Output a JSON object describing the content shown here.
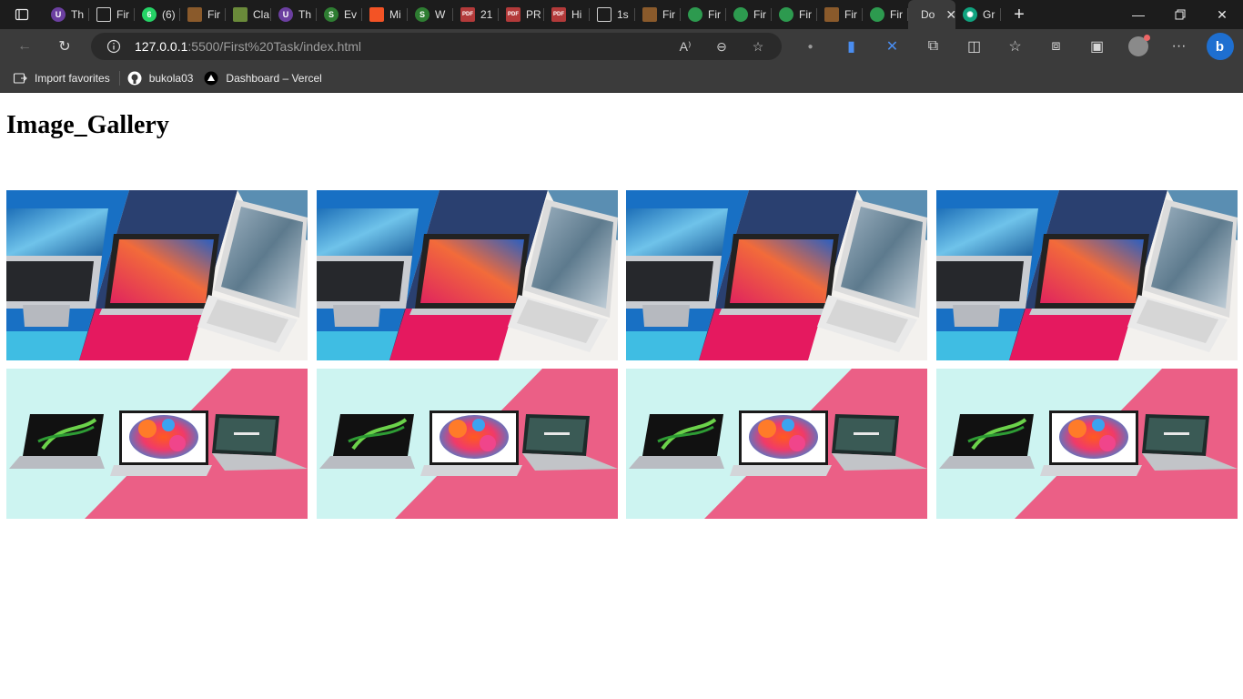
{
  "tabs": [
    {
      "label": "Th",
      "icon": "udemy-icon",
      "color": "#6b3fa0",
      "glyph": "U"
    },
    {
      "label": "Fir",
      "icon": "document-icon",
      "color": "#9a9a9a",
      "glyph": ""
    },
    {
      "label": "(6)",
      "icon": "whatsapp-icon",
      "color": "#25d366",
      "glyph": "6"
    },
    {
      "label": "Fir",
      "icon": "classroom-icon",
      "color": "#8a5a2b",
      "glyph": ""
    },
    {
      "label": "Cla",
      "icon": "classroom-icon",
      "color": "#6a8a3a",
      "glyph": ""
    },
    {
      "label": "Th",
      "icon": "udemy-icon",
      "color": "#6b3fa0",
      "glyph": "U"
    },
    {
      "label": "Ev",
      "icon": "s-icon",
      "color": "#2e7d32",
      "glyph": "S"
    },
    {
      "label": "Mi",
      "icon": "microsoft-icon",
      "color": "#f35325",
      "glyph": ""
    },
    {
      "label": "W",
      "icon": "s-icon",
      "color": "#2e7d32",
      "glyph": "S"
    },
    {
      "label": "21",
      "icon": "pdf-icon",
      "color": "#b33a3a",
      "glyph": "PDF"
    },
    {
      "label": "PR",
      "icon": "pdf-icon",
      "color": "#b33a3a",
      "glyph": "PDF"
    },
    {
      "label": "Hi",
      "icon": "pdf-icon",
      "color": "#b33a3a",
      "glyph": "PDF"
    },
    {
      "label": "1s",
      "icon": "document-icon",
      "color": "#9a9a9a",
      "glyph": ""
    },
    {
      "label": "Fir",
      "icon": "classroom-icon",
      "color": "#8a5a2b",
      "glyph": ""
    },
    {
      "label": "Fir",
      "icon": "drive-icon",
      "color": "#2d9a4f",
      "glyph": ""
    },
    {
      "label": "Fir",
      "icon": "drive-icon",
      "color": "#2d9a4f",
      "glyph": ""
    },
    {
      "label": "Fir",
      "icon": "drive-icon",
      "color": "#2d9a4f",
      "glyph": ""
    },
    {
      "label": "Fir",
      "icon": "classroom-icon",
      "color": "#8a5a2b",
      "glyph": ""
    },
    {
      "label": "Fir",
      "icon": "drive-icon",
      "color": "#2d9a4f",
      "glyph": ""
    },
    {
      "label": "Do",
      "icon": "document-icon",
      "color": "#9a9a9a",
      "glyph": ""
    }
  ],
  "active_tab": {
    "label": "Do",
    "icon": "document-icon"
  },
  "last_tab": {
    "label": "Gr",
    "icon": "chatgpt-icon",
    "color": "#10a37f"
  },
  "address": {
    "host": "127.0.0.1",
    "path": ":5500/First%20Task/index.html"
  },
  "favorites": [
    {
      "label": "Import favorites",
      "icon": "import-favorites-icon"
    },
    {
      "label": "bukola03",
      "icon": "github-icon"
    },
    {
      "label": "Dashboard – Vercel",
      "icon": "vercel-icon"
    }
  ],
  "page": {
    "title": "Image_Gallery",
    "images": [
      {
        "row": 1,
        "subject": "three-laptops-diagonal-panels"
      },
      {
        "row": 1,
        "subject": "three-laptops-diagonal-panels"
      },
      {
        "row": 1,
        "subject": "three-laptops-diagonal-panels"
      },
      {
        "row": 1,
        "subject": "three-laptops-diagonal-panels"
      },
      {
        "row": 2,
        "subject": "three-laptops-mint-pink-background"
      },
      {
        "row": 2,
        "subject": "three-laptops-mint-pink-background"
      },
      {
        "row": 2,
        "subject": "three-laptops-mint-pink-background"
      },
      {
        "row": 2,
        "subject": "three-laptops-mint-pink-background"
      }
    ]
  },
  "colors": {
    "tabstrip_bg": "#1c1c1c",
    "toolbar_bg": "#3b3b3b",
    "omnibox_bg": "#2a2a2a",
    "page_bg": "#ffffff"
  }
}
